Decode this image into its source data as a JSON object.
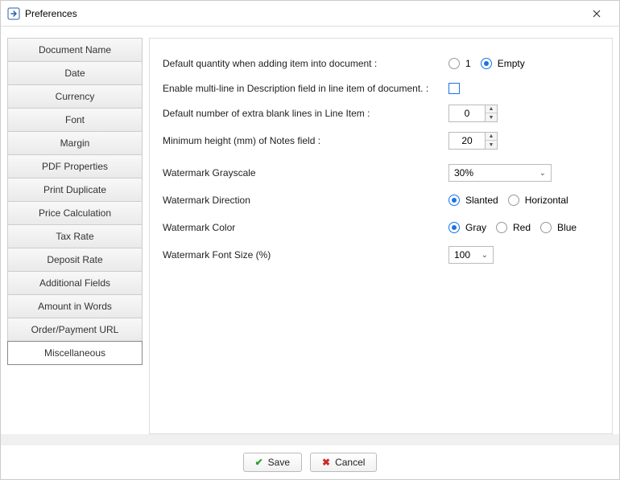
{
  "window": {
    "title": "Preferences"
  },
  "sidebar": {
    "items": [
      "Document Name",
      "Date",
      "Currency",
      "Font",
      "Margin",
      "PDF Properties",
      "Print Duplicate",
      "Price Calculation",
      "Tax Rate",
      "Deposit Rate",
      "Additional Fields",
      "Amount in Words",
      "Order/Payment URL",
      "Miscellaneous"
    ],
    "selected": "Miscellaneous"
  },
  "form": {
    "default_qty": {
      "label": "Default quantity when adding item into document  :",
      "options": {
        "one": "1",
        "empty": "Empty"
      },
      "value": "Empty"
    },
    "multiline": {
      "label": "Enable multi-line in Description field in line item of document. :",
      "checked": false
    },
    "blank_lines": {
      "label": "Default number of extra blank lines in Line Item :",
      "value": "0"
    },
    "notes_height": {
      "label": "Minimum height (mm) of Notes field :",
      "value": "20"
    },
    "wm_grayscale": {
      "label": "Watermark Grayscale",
      "value": "30%"
    },
    "wm_direction": {
      "label": "Watermark Direction",
      "options": {
        "slanted": "Slanted",
        "horizontal": "Horizontal"
      },
      "value": "Slanted"
    },
    "wm_color": {
      "label": "Watermark Color",
      "options": {
        "gray": "Gray",
        "red": "Red",
        "blue": "Blue"
      },
      "value": "Gray"
    },
    "wm_fontsize": {
      "label": "Watermark Font Size (%)",
      "value": "100"
    }
  },
  "footer": {
    "save": "Save",
    "cancel": "Cancel"
  }
}
